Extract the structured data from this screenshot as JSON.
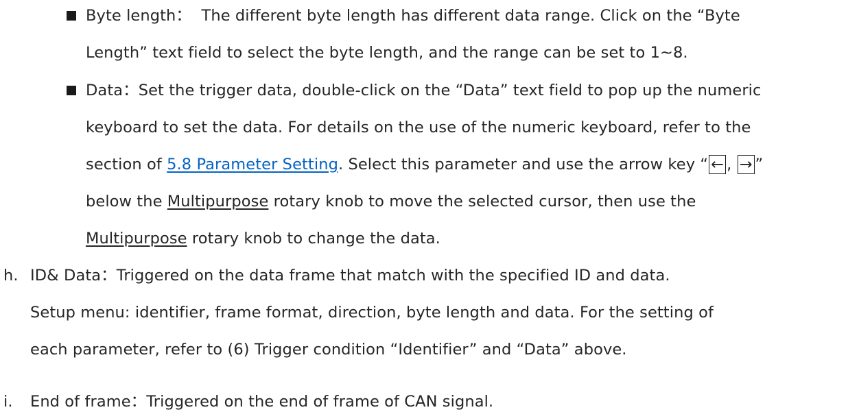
{
  "bullets": {
    "byte_length": {
      "line1": "Byte length：  The different byte length has different data range. Click on the “Byte",
      "line2": "Length” text field to select the byte length, and the range can be set to 1~8."
    },
    "data": {
      "line1": "Data：Set the trigger data, double-click on the “Data” text field to pop up the numeric",
      "line2": "keyboard to set the data. For details on the use of the numeric keyboard, refer to the",
      "line3_prefix": "section of ",
      "line3_link": "5.8 Parameter Setting",
      "line3_mid": ". Select this parameter and use the arrow key “",
      "key_left": "←",
      "key_sep": ", ",
      "key_right": "→",
      "line3_end": "”",
      "line4_prefix": "below the ",
      "line4_knob": "Multipurpose",
      "line4_suffix": " rotary knob to move the selected cursor, then use the",
      "line5_knob": "Multipurpose",
      "line5_suffix": " rotary knob to change the data."
    }
  },
  "items": {
    "h": {
      "marker": "h.",
      "line1": "ID& Data：Triggered on the data frame that match with the specified ID and data.",
      "line2": "Setup menu: identifier, frame format, direction, byte length and data. For the setting of",
      "line3": "each parameter, refer to (6) Trigger condition “Identifier” and “Data” above."
    },
    "i": {
      "marker": "i.",
      "line1": "End of frame：Triggered on the end of frame of CAN signal."
    }
  }
}
